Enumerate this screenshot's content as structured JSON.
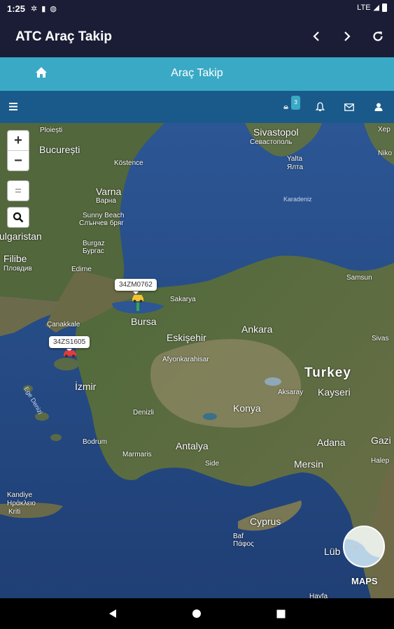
{
  "status": {
    "time": "1:25",
    "network": "LTE"
  },
  "app": {
    "title": "ATC Araç Takip"
  },
  "subheader": {
    "title": "Araç Takip"
  },
  "toolbar": {
    "vehicle_badge": "3"
  },
  "map": {
    "zoom_in": "+",
    "zoom_out": "−",
    "labels": {
      "ploiesti": "Ploiești",
      "bucuresti": "București",
      "kustence": "Köstence",
      "varna": "Varna",
      "varna_cyr": "Варна",
      "sunny_beach": "Sunny Beach",
      "sunny_beach_cyr": "Слънчев бряг",
      "burgaz": "Burgaz",
      "burgaz_cyr": "Бургас",
      "bulgaristan": "ulgaristan",
      "filibe": "Filibe",
      "filibe_cyr": "Пловдив",
      "edirne": "Edirne",
      "sivastopol": "Sivastopol",
      "sivastopol_cyr": "Севастополь",
      "yalta": "Yalta",
      "yalta_cyr": "Ялта",
      "karadeniz": "Karadeniz",
      "samsun": "Samsun",
      "sakarya": "Sakarya",
      "bursa": "Bursa",
      "canakkale": "Çanakkale",
      "eskisehir": "Eskişehir",
      "ankara": "Ankara",
      "afyon": "Afyonkarahisar",
      "turkey": "Turkey",
      "aksaray": "Aksaray",
      "kayseri": "Kayseri",
      "sivas": "Sivas",
      "izmir": "İzmir",
      "ege": "Ege Denizi",
      "denizli": "Denizli",
      "konya": "Konya",
      "bodrum": "Bodrum",
      "marmaris": "Marmaris",
      "antalya": "Antalya",
      "side": "Side",
      "adana": "Adana",
      "mersin": "Mersin",
      "gazi": "Gazi",
      "kandiye": "Kandiye",
      "kandiye_gr": "Ηράκλειο",
      "kriti": "Kriti",
      "cyprus": "Cyprus",
      "baf": "Baf",
      "baf_gr": "Πάφος",
      "lubnan": "Lüb",
      "hayfa": "Hayfa",
      "nikea": "Niko",
      "hpo": "Хер",
      "hpo2": "Хер",
      "halep": "Halep"
    },
    "vehicles": [
      {
        "plate": "34ZM0762",
        "color": "#f2c42c"
      },
      {
        "plate": "34ZS1605",
        "color": "#e23b3b"
      }
    ],
    "brand": "MAPS"
  }
}
